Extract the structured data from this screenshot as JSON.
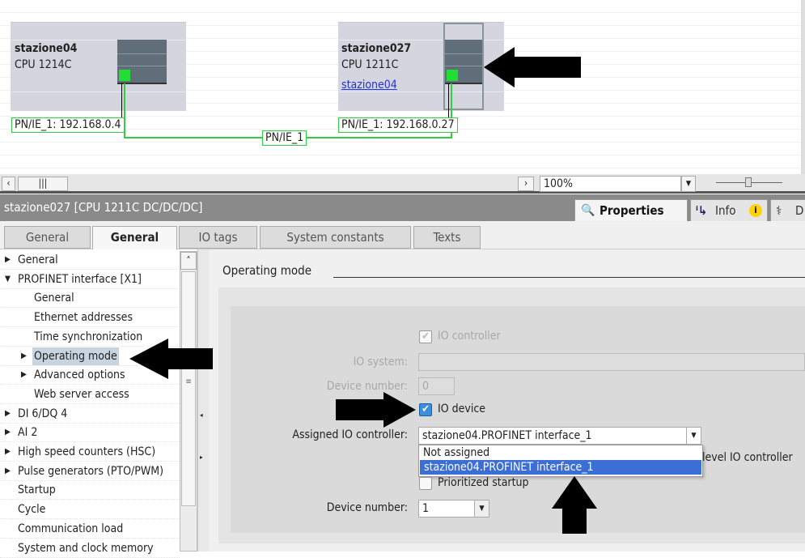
{
  "network_view": {
    "devices": [
      {
        "name": "stazione04",
        "cpu": "CPU 1214C",
        "interface_label": "PN/IE_1:  192.168.0.4"
      },
      {
        "name": "stazione027",
        "cpu": "CPU 1211C",
        "controller_link": "stazione04",
        "interface_label": "PN/IE_1:  192.168.0.27"
      }
    ],
    "subnet_label": "PN/IE_1",
    "zoom_value": "100%"
  },
  "inspector": {
    "title": "stazione027 [CPU 1211C DC/DC/DC]",
    "view_tabs": [
      {
        "label": "Properties",
        "icon": "properties-icon"
      },
      {
        "label": "Info",
        "icon": "info-icon"
      },
      {
        "label": "D",
        "icon": "diagnostics-icon"
      }
    ],
    "tabs": [
      "General",
      "General",
      "IO tags",
      "System constants",
      "Texts"
    ],
    "active_tab": 1
  },
  "tree": [
    {
      "label": "General",
      "level": 0,
      "arrow": "right"
    },
    {
      "label": "PROFINET interface [X1]",
      "level": 0,
      "arrow": "down"
    },
    {
      "label": "General",
      "level": 1
    },
    {
      "label": "Ethernet addresses",
      "level": 1
    },
    {
      "label": "Time synchronization",
      "level": 1
    },
    {
      "label": "Operating mode",
      "level": 1,
      "arrow": "right",
      "selected": true
    },
    {
      "label": "Advanced options",
      "level": 1,
      "arrow": "right"
    },
    {
      "label": "Web server access",
      "level": 1
    },
    {
      "label": "DI 6/DQ 4",
      "level": 0,
      "arrow": "right"
    },
    {
      "label": "AI 2",
      "level": 0,
      "arrow": "right"
    },
    {
      "label": "High speed counters (HSC)",
      "level": 0,
      "arrow": "right"
    },
    {
      "label": "Pulse generators (PTO/PWM)",
      "level": 0,
      "arrow": "right"
    },
    {
      "label": "Startup",
      "level": 0
    },
    {
      "label": "Cycle",
      "level": 0
    },
    {
      "label": "Communication load",
      "level": 0
    },
    {
      "label": "System and clock memory",
      "level": 0
    }
  ],
  "operating_mode": {
    "section_title": "Operating mode",
    "io_controller_label": "IO controller",
    "io_controller_checked": true,
    "io_system_label": "IO system:",
    "io_system_value": "",
    "device_number_label_disabled": "Device number:",
    "device_number_disabled_value": "0",
    "io_device_label": "IO device",
    "io_device_checked": true,
    "assigned_controller_label": "Assigned IO controller:",
    "assigned_controller_value": "stazione04.PROFINET interface_1",
    "dropdown_options": [
      "Not assigned",
      "stazione04.PROFINET interface_1"
    ],
    "dropdown_selected": 1,
    "hidden_partial_text": "level IO controller",
    "prioritized_startup_label": "Prioritized startup",
    "prioritized_startup_checked": false,
    "device_number_label": "Device number:",
    "device_number_value": "1"
  }
}
